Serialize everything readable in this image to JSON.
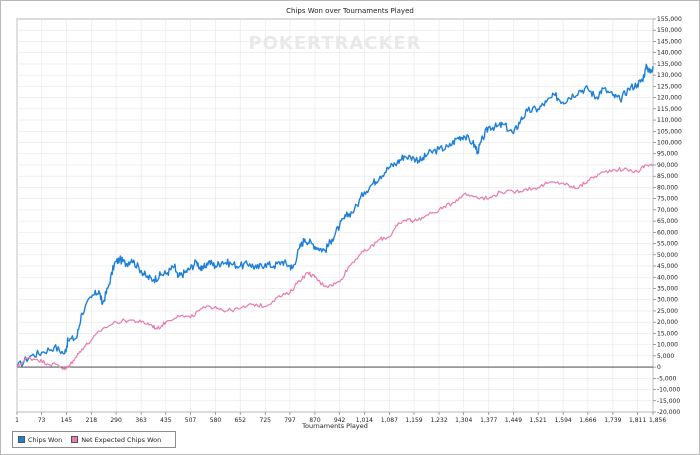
{
  "chart_data": {
    "type": "line",
    "title": "Chips Won over Tournaments Played",
    "xlabel": "Tournaments Played",
    "ylabel": "",
    "xlim": [
      1,
      1856
    ],
    "ylim": [
      -20000,
      155000
    ],
    "x_ticks": [
      "1",
      "73",
      "145",
      "218",
      "290",
      "363",
      "435",
      "507",
      "580",
      "652",
      "725",
      "797",
      "870",
      "942",
      "1,014",
      "1,087",
      "1,159",
      "1,232",
      "1,304",
      "1,377",
      "1,449",
      "1,521",
      "1,594",
      "1,666",
      "1,739",
      "1,811",
      "1,856"
    ],
    "y_ticks": [
      "-20,000",
      "-15,000",
      "-10,000",
      "-5,000",
      "0",
      "5,000",
      "10,000",
      "15,000",
      "20,000",
      "25,000",
      "30,000",
      "35,000",
      "40,000",
      "45,000",
      "50,000",
      "55,000",
      "60,000",
      "65,000",
      "70,000",
      "75,000",
      "80,000",
      "85,000",
      "90,000",
      "95,000",
      "100,000",
      "105,000",
      "110,000",
      "115,000",
      "120,000",
      "125,000",
      "130,000",
      "135,000",
      "140,000",
      "145,000",
      "150,000",
      "155,000"
    ],
    "grid": true,
    "legend_position": "bottom-left",
    "series": [
      {
        "name": "Chips Won",
        "color": "#1e7fd8",
        "points": [
          [
            1,
            0
          ],
          [
            40,
            5000
          ],
          [
            73,
            6500
          ],
          [
            110,
            9000
          ],
          [
            140,
            6000
          ],
          [
            150,
            12000
          ],
          [
            175,
            13000
          ],
          [
            190,
            24000
          ],
          [
            218,
            31000
          ],
          [
            240,
            34000
          ],
          [
            250,
            28000
          ],
          [
            268,
            36000
          ],
          [
            285,
            46000
          ],
          [
            300,
            48000
          ],
          [
            320,
            46000
          ],
          [
            335,
            48000
          ],
          [
            363,
            43000
          ],
          [
            380,
            40000
          ],
          [
            400,
            39000
          ],
          [
            420,
            41000
          ],
          [
            440,
            42000
          ],
          [
            460,
            45000
          ],
          [
            470,
            40000
          ],
          [
            490,
            42000
          ],
          [
            507,
            44000
          ],
          [
            525,
            47000
          ],
          [
            540,
            43000
          ],
          [
            560,
            47000
          ],
          [
            580,
            45000
          ],
          [
            600,
            47000
          ],
          [
            625,
            46000
          ],
          [
            652,
            45000
          ],
          [
            680,
            46000
          ],
          [
            700,
            44000
          ],
          [
            725,
            46000
          ],
          [
            750,
            45000
          ],
          [
            775,
            47000
          ],
          [
            797,
            45000
          ],
          [
            805,
            44000
          ],
          [
            825,
            53000
          ],
          [
            840,
            57000
          ],
          [
            860,
            55000
          ],
          [
            880,
            53000
          ],
          [
            900,
            52000
          ],
          [
            920,
            57000
          ],
          [
            942,
            63000
          ],
          [
            960,
            67000
          ],
          [
            985,
            70000
          ],
          [
            1014,
            78000
          ],
          [
            1040,
            82000
          ],
          [
            1060,
            85000
          ],
          [
            1087,
            89000
          ],
          [
            1110,
            91000
          ],
          [
            1130,
            94000
          ],
          [
            1159,
            93000
          ],
          [
            1180,
            92000
          ],
          [
            1200,
            95000
          ],
          [
            1232,
            97000
          ],
          [
            1260,
            98000
          ],
          [
            1285,
            102000
          ],
          [
            1304,
            103000
          ],
          [
            1330,
            100000
          ],
          [
            1345,
            96000
          ],
          [
            1360,
            102000
          ],
          [
            1377,
            107000
          ],
          [
            1400,
            107000
          ],
          [
            1420,
            108000
          ],
          [
            1449,
            104000
          ],
          [
            1470,
            110000
          ],
          [
            1490,
            114000
          ],
          [
            1521,
            115000
          ],
          [
            1545,
            118000
          ],
          [
            1570,
            121000
          ],
          [
            1594,
            118000
          ],
          [
            1610,
            120000
          ],
          [
            1640,
            123000
          ],
          [
            1666,
            124000
          ],
          [
            1690,
            120000
          ],
          [
            1710,
            124000
          ],
          [
            1739,
            121000
          ],
          [
            1760,
            119000
          ],
          [
            1785,
            124000
          ],
          [
            1811,
            126000
          ],
          [
            1825,
            128000
          ],
          [
            1838,
            134000
          ],
          [
            1848,
            131000
          ],
          [
            1856,
            134000
          ]
        ]
      },
      {
        "name": "Net Expected Chips Won",
        "color": "#e87bb0",
        "points": [
          [
            1,
            0
          ],
          [
            30,
            4000
          ],
          [
            60,
            3500
          ],
          [
            90,
            1500
          ],
          [
            120,
            1000
          ],
          [
            140,
            -1000
          ],
          [
            150,
            0
          ],
          [
            165,
            3000
          ],
          [
            190,
            8000
          ],
          [
            218,
            12000
          ],
          [
            250,
            17000
          ],
          [
            290,
            20000
          ],
          [
            330,
            21000
          ],
          [
            363,
            20000
          ],
          [
            390,
            19000
          ],
          [
            410,
            17000
          ],
          [
            435,
            20000
          ],
          [
            470,
            23000
          ],
          [
            507,
            22000
          ],
          [
            540,
            26000
          ],
          [
            580,
            27000
          ],
          [
            610,
            25000
          ],
          [
            652,
            26000
          ],
          [
            690,
            28000
          ],
          [
            725,
            27000
          ],
          [
            760,
            31000
          ],
          [
            797,
            33000
          ],
          [
            820,
            38000
          ],
          [
            850,
            42000
          ],
          [
            870,
            40000
          ],
          [
            890,
            37000
          ],
          [
            910,
            36000
          ],
          [
            942,
            38000
          ],
          [
            970,
            45000
          ],
          [
            1000,
            50000
          ],
          [
            1030,
            53000
          ],
          [
            1060,
            57000
          ],
          [
            1087,
            58000
          ],
          [
            1110,
            63000
          ],
          [
            1140,
            66000
          ],
          [
            1159,
            65000
          ],
          [
            1190,
            67000
          ],
          [
            1232,
            70000
          ],
          [
            1270,
            73000
          ],
          [
            1304,
            77000
          ],
          [
            1340,
            76000
          ],
          [
            1377,
            75000
          ],
          [
            1410,
            78000
          ],
          [
            1449,
            78000
          ],
          [
            1480,
            79000
          ],
          [
            1521,
            80000
          ],
          [
            1550,
            82000
          ],
          [
            1594,
            82000
          ],
          [
            1620,
            80000
          ],
          [
            1640,
            80000
          ],
          [
            1666,
            83000
          ],
          [
            1700,
            86000
          ],
          [
            1739,
            88000
          ],
          [
            1770,
            88000
          ],
          [
            1811,
            87000
          ],
          [
            1835,
            90000
          ],
          [
            1856,
            90000
          ]
        ]
      }
    ]
  },
  "watermark": "POKERTRACKER"
}
